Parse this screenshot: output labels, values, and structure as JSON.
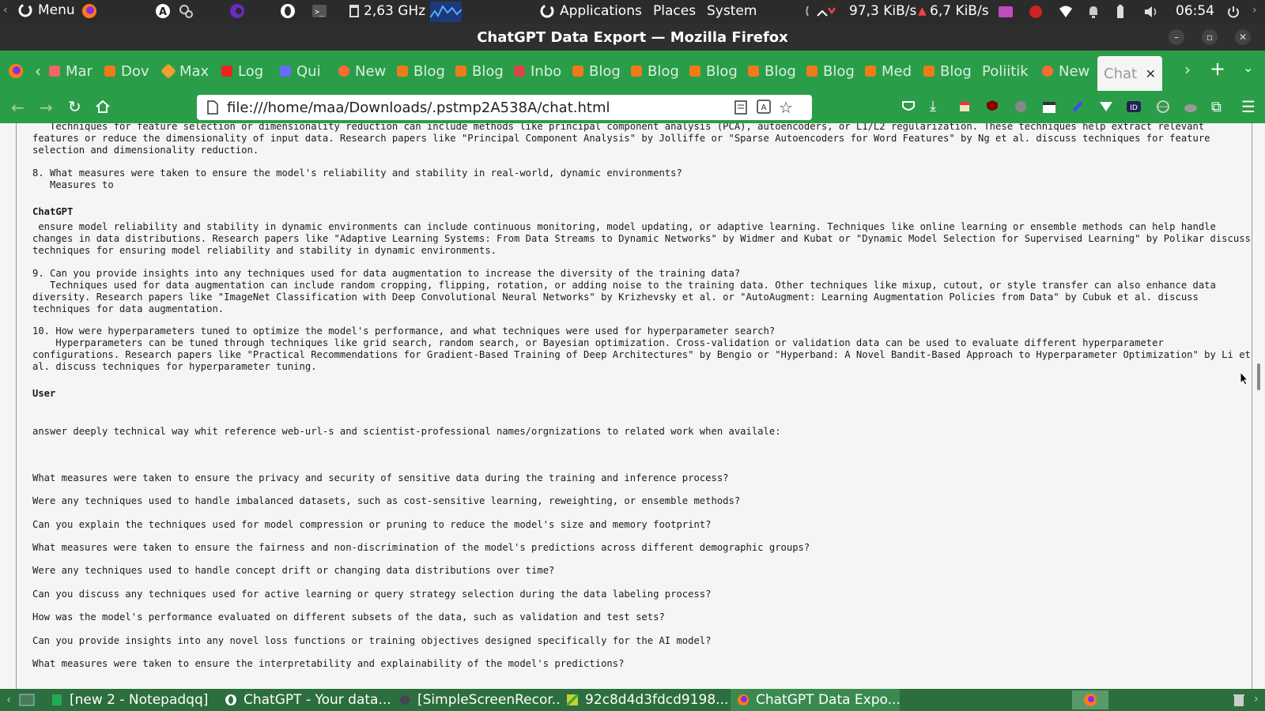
{
  "system_bar": {
    "menu_label": "Menu",
    "cpu_freq": "2,63 GHz",
    "applications": "Applications",
    "places": "Places",
    "system": "System",
    "net_down": "97,3 KiB/s",
    "net_up": "6,7 KiB/s",
    "clock": "06:54"
  },
  "window": {
    "title": "ChatGPT Data Export — Mozilla Firefox"
  },
  "tabs": [
    {
      "label": "Mar",
      "color": "#e66"
    },
    {
      "label": "Dov",
      "color": "#f07a1a"
    },
    {
      "label": "Max",
      "color": "#f0a030"
    },
    {
      "label": "Log",
      "color": "#e22"
    },
    {
      "label": "Qui",
      "color": "#6a6aff"
    },
    {
      "label": "New",
      "color": "#ff6a33"
    },
    {
      "label": "Blog",
      "color": "#f07a1a"
    },
    {
      "label": "Blog",
      "color": "#f07a1a"
    },
    {
      "label": "Inbo",
      "color": "#d44"
    },
    {
      "label": "Blog",
      "color": "#f07a1a"
    },
    {
      "label": "Blog",
      "color": "#f07a1a"
    },
    {
      "label": "Blog",
      "color": "#f07a1a"
    },
    {
      "label": "Blog",
      "color": "#f07a1a"
    },
    {
      "label": "Blog",
      "color": "#f07a1a"
    },
    {
      "label": "Med",
      "color": "#f07a1a"
    },
    {
      "label": "Blog",
      "color": "#f07a1a"
    },
    {
      "label": "Poliitik",
      "color": ""
    },
    {
      "label": "New",
      "color": "#ff6a33"
    }
  ],
  "active_tab": {
    "label": "Chat"
  },
  "url": "file:///home/maa/Downloads/.pstmp2A538A/chat.html",
  "content": {
    "block1": "   Techniques for feature selection or dimensionality reduction can include methods like principal component analysis (PCA), autoencoders, or L1/L2 regularization. These techniques help extract relevant\nfeatures or reduce the dimensionality of input data. Research papers like \"Principal Component Analysis\" by Jolliffe or \"Sparse Autoencoders for Word Features\" by Ng et al. discuss techniques for feature\nselection and dimensionality reduction.",
    "block2": "8. What measures were taken to ensure the model's reliability and stability in real-world, dynamic environments?\n   Measures to",
    "speaker1": "ChatGPT",
    "block3": " ensure model reliability and stability in dynamic environments can include continuous monitoring, model updating, or adaptive learning. Techniques like online learning or ensemble methods can help handle\nchanges in data distributions. Research papers like \"Adaptive Learning Systems: From Data Streams to Dynamic Networks\" by Widmer and Kubat or \"Dynamic Model Selection for Supervised Learning\" by Polikar discuss\ntechniques for ensuring model reliability and stability in dynamic environments.",
    "block4": "9. Can you provide insights into any techniques used for data augmentation to increase the diversity of the training data?\n   Techniques used for data augmentation can include random cropping, flipping, rotation, or adding noise to the training data. Other techniques like mixup, cutout, or style transfer can also enhance data\ndiversity. Research papers like \"ImageNet Classification with Deep Convolutional Neural Networks\" by Krizhevsky et al. or \"AutoAugment: Learning Augmentation Policies from Data\" by Cubuk et al. discuss\ntechniques for data augmentation.",
    "block5": "10. How were hyperparameters tuned to optimize the model's performance, and what techniques were used for hyperparameter search?\n    Hyperparameters can be tuned through techniques like grid search, random search, or Bayesian optimization. Cross-validation or validation data can be used to evaluate different hyperparameter\nconfigurations. Research papers like \"Practical Recommendations for Gradient-Based Training of Deep Architectures\" by Bengio or \"Hyperband: A Novel Bandit-Based Approach to Hyperparameter Optimization\" by Li et\nal. discuss techniques for hyperparameter tuning.",
    "speaker2": "User",
    "prompt": "answer deeply technical way whit reference web-url-s and scientist-professional names/orgnizations to related work when availale:",
    "questions": [
      "What measures were taken to ensure the privacy and security of sensitive data during the training and inference process?",
      "Were any techniques used to handle imbalanced datasets, such as cost-sensitive learning, reweighting, or ensemble methods?",
      "Can you explain the techniques used for model compression or pruning to reduce the model's size and memory footprint?",
      "What measures were taken to ensure the fairness and non-discrimination of the model's predictions across different demographic groups?",
      "Were any techniques used to handle concept drift or changing data distributions over time?",
      "Can you discuss any techniques used for active learning or query strategy selection during the data labeling process?",
      "How was the model's performance evaluated on different subsets of the data, such as validation and test sets?",
      "Can you provide insights into any novel loss functions or training objectives designed specifically for the AI model?",
      "What measures were taken to ensure the interpretability and explainability of the model's predictions?"
    ]
  },
  "taskbar": [
    {
      "label": "[new 2 - Notepadqq]"
    },
    {
      "label": "ChatGPT - Your data..."
    },
    {
      "label": "[SimpleScreenRecor..."
    },
    {
      "label": "92c8d4d3fdcd9198..."
    },
    {
      "label": "ChatGPT Data Expo..."
    }
  ]
}
